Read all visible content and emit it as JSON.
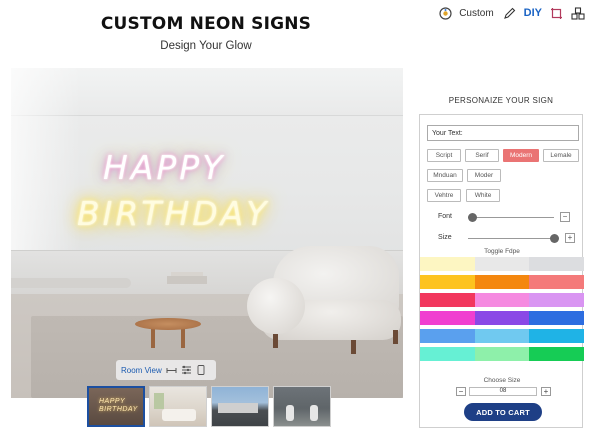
{
  "header": {
    "title": "CUSTOM NEON SIGNS",
    "subtitle": "Design Your Glow"
  },
  "topbar": {
    "custom_label": "Custom",
    "diy_label": "DIY",
    "icons": [
      "custom-palette-icon",
      "pencil-icon",
      "crop-frame-icon",
      "boxes-icon"
    ]
  },
  "preview": {
    "neon_line_1": "HAPPY",
    "neon_line_2": "BIRTHDAY",
    "room_view_label": "Room View",
    "thumbnails": [
      {
        "mini_1": "HAPPY",
        "mini_2": "BIRTHDAY"
      },
      {},
      {},
      {}
    ]
  },
  "panel": {
    "title": "PERSONAIZE YOUR SIGN",
    "text_input_value": "Your Text:",
    "fonts": [
      "Script",
      "Serif",
      "Modern",
      "Lemale",
      "Mnduan",
      "Moder",
      "Vehtre",
      "White"
    ],
    "selected_font": "Modern",
    "font_label": "Font",
    "size_label": "Size",
    "font_slider_fraction": 0.05,
    "size_slider_fraction": 1.0,
    "toggle_label": "Toggle Fdpe",
    "swatches": [
      [
        "#fdf6c2",
        "#e8e8e8",
        "#dcdde0"
      ],
      [
        "#fdc31f",
        "#f4870f",
        "#f47a7a"
      ],
      [
        "#f2375e",
        "#f589e0",
        "#d995f2"
      ],
      [
        "#f03fd0",
        "#8a48e6",
        "#2d6de0"
      ],
      [
        "#5aa0ee",
        "#70c9f0",
        "#1fb3e6"
      ],
      [
        "#66f0d4",
        "#8ef0aa",
        "#16cc55"
      ]
    ],
    "choose_size_label": "Choose Size",
    "size_value": "08",
    "size_minus": "−",
    "size_plus": "+",
    "font_minus": "−",
    "size_plus_small": "+",
    "add_to_cart_label": "ADD TO CART"
  }
}
